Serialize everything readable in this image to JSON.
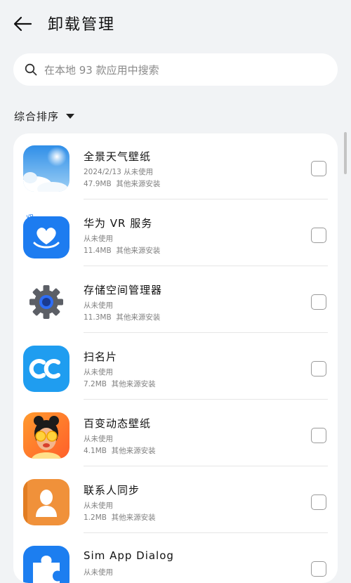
{
  "header": {
    "title": "卸载管理"
  },
  "search": {
    "placeholder": "在本地 93 款应用中搜索"
  },
  "sort": {
    "label": "综合排序"
  },
  "apps": [
    {
      "name": "全景天气壁纸",
      "usage": "2024/2/13   从未使用",
      "size": "47.9MB",
      "source": "其他来源安装",
      "icon": "weather-wallpaper-icon"
    },
    {
      "name": "华为 VR 服务",
      "usage": "从未使用",
      "size": "11.4MB",
      "source": "其他来源安装",
      "icon": "vr-service-icon"
    },
    {
      "name": "存储空间管理器",
      "usage": "从未使用",
      "size": "11.3MB",
      "source": "其他来源安装",
      "icon": "gear-icon"
    },
    {
      "name": "扫名片",
      "usage": "从未使用",
      "size": "7.2MB",
      "source": "其他来源安装",
      "icon": "cc-card-scanner-icon"
    },
    {
      "name": "百变动态壁纸",
      "usage": "从未使用",
      "size": "4.1MB",
      "source": "其他来源安装",
      "icon": "girl-wallpaper-icon"
    },
    {
      "name": "联系人同步",
      "usage": "从未使用",
      "size": "1.2MB",
      "source": "其他来源安装",
      "icon": "contact-person-icon"
    },
    {
      "name": "Sim App Dialog",
      "usage": "从未使用",
      "size": "",
      "source": "",
      "icon": "puzzle-icon"
    }
  ]
}
